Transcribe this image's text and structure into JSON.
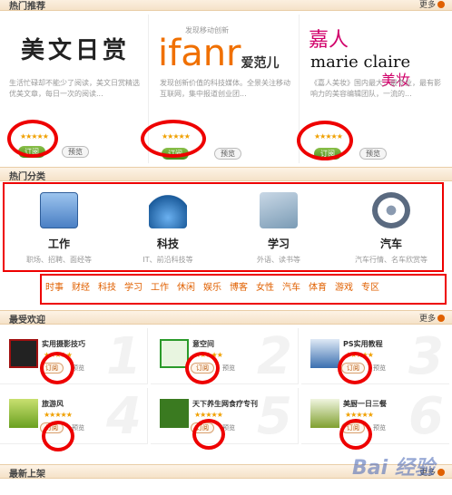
{
  "sections": {
    "hot_recommend": {
      "title": "热门推荐",
      "more": "更多"
    },
    "hot_categories": {
      "title": "热门分类"
    },
    "most_popular": {
      "title": "最受欢迎",
      "more": "更多"
    },
    "new_arrivals": {
      "title": "最新上架",
      "more": "更多"
    }
  },
  "recommend": [
    {
      "logo": "美文日赏",
      "desc": "生活忙碌却不能少了阅读，美文日赏精选优美文章，每日一次的阅读...",
      "stars": "★★★★★",
      "subscribe": "订阅",
      "preview": "预览"
    },
    {
      "logo": "ifanr",
      "logo_sub": "发现移动创新",
      "logo_tail": "爱范儿",
      "desc": "发现创新价值的科技媒体。全景关注移动互联网，集中报道创业团...",
      "stars": "★★★★★",
      "subscribe": "订阅",
      "preview": "预览"
    },
    {
      "logo": "marie claire",
      "logo_cn1": "嘉人",
      "logo_cn2": "美妆",
      "desc": "《嘉人美妆》国内最大，最专业，最有影响力的美容编辑团队，一流的...",
      "stars": "★★★★★",
      "subscribe": "订阅",
      "preview": "预览"
    }
  ],
  "categories": [
    {
      "name": "工作",
      "sub": "职场、招聘、面经等",
      "icon": "folder-icon",
      "color": "#5b8fd0"
    },
    {
      "name": "科技",
      "sub": "IT、前沿科技等",
      "icon": "flask-icon",
      "color": "#3a7fc2"
    },
    {
      "name": "学习",
      "sub": "外语、读书等",
      "icon": "books-icon",
      "color": "#7a9bb5"
    },
    {
      "name": "汽车",
      "sub": "汽车行情、名车欣赏等",
      "icon": "steering-wheel-icon",
      "color": "#5a6a80"
    }
  ],
  "tags": [
    "时事",
    "财经",
    "科技",
    "学习",
    "工作",
    "休闲",
    "娱乐",
    "博客",
    "女性",
    "汽车",
    "体育",
    "游戏",
    "专区"
  ],
  "popular": [
    {
      "rank": "1",
      "name": "实用摄影技巧",
      "stars": "★★★★★",
      "subscribe": "订阅",
      "preview": "预览",
      "icon": "camera-tips-icon",
      "color": "#a01010"
    },
    {
      "rank": "2",
      "name": "意空间",
      "stars": "★★★★★",
      "subscribe": "订阅",
      "preview": "预览",
      "icon": "yi-space-icon",
      "color": "#2a9a2a"
    },
    {
      "rank": "3",
      "name": "PS实用教程",
      "stars": "★★★★★",
      "subscribe": "订阅",
      "preview": "预览",
      "icon": "ps-tutorial-icon",
      "color": "#3a6fb0"
    },
    {
      "rank": "4",
      "name": "旅游风",
      "stars": "★★★★★",
      "subscribe": "订阅",
      "preview": "预览",
      "icon": "travel-icon",
      "color": "#6aa020"
    },
    {
      "rank": "5",
      "name": "天下养生网食疗专刊",
      "stars": "★★★★★",
      "subscribe": "订阅",
      "preview": "预览",
      "icon": "diet-therapy-icon",
      "color": "#3a7a20"
    },
    {
      "rank": "6",
      "name": "美厨一日三餐",
      "stars": "★★★★★",
      "subscribe": "订阅",
      "preview": "预览",
      "icon": "cooking-icon",
      "color": "#80a030"
    }
  ],
  "watermark": "Bai 经验"
}
